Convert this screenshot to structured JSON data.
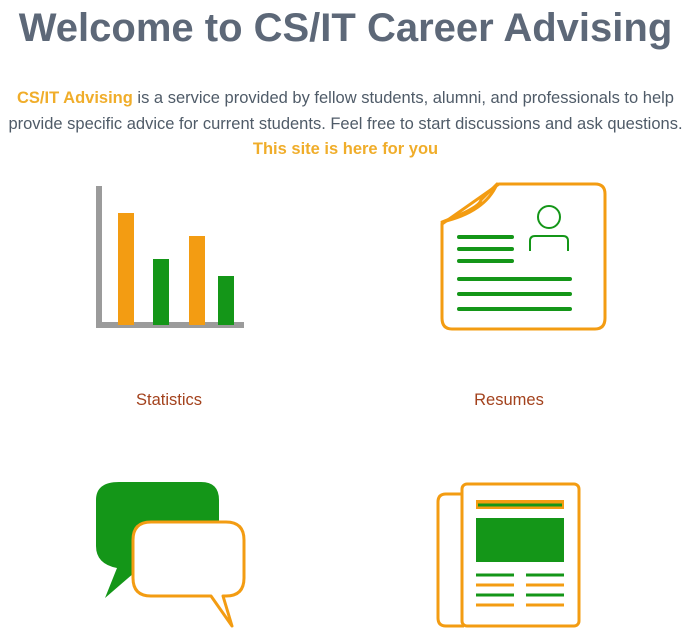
{
  "header": {
    "title": "Welcome to CS/IT Career Advising"
  },
  "intro": {
    "brand": "CS/IT Advising",
    "text_part1": " is a service provided by fellow students, alumni, and professionals to help provide specific advice for current students. Feel free to start discussions and ask questions. ",
    "highlight": "This site is here for you"
  },
  "tiles": [
    {
      "label": "Statistics",
      "icon": "bar-chart-icon"
    },
    {
      "label": "Resumes",
      "icon": "resume-document-icon"
    },
    {
      "label": "",
      "icon": "chat-bubbles-icon"
    },
    {
      "label": "",
      "icon": "newspaper-icon"
    }
  ],
  "colors": {
    "title": "#5d6878",
    "body_text": "#4f5b68",
    "accent_orange": "#f0ad2a",
    "icon_orange": "#f39c12",
    "icon_green": "#149618",
    "axis_gray": "#9b9b9b",
    "label_text": "#a3421d"
  }
}
